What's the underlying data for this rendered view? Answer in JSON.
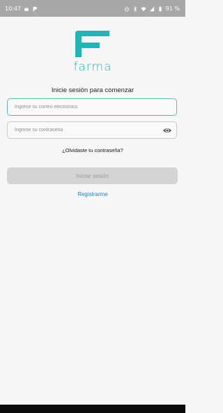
{
  "status_bar": {
    "time": "10:47",
    "battery": "91 %"
  },
  "brand": {
    "name": "farma",
    "color": "#26b3b4"
  },
  "login": {
    "subtitle": "Inicie sesión para comenzar",
    "email_placeholder": "Ingrese su correo electrónico",
    "password_placeholder": "Ingrese su contraseña",
    "forgot_password": "¿Olvidaste tu contraseña?",
    "submit_label": "Iniciar sesión",
    "register_label": "Registrarme"
  },
  "colors": {
    "accent": "#26b3b4",
    "link": "#2a7fb8",
    "disabled_button": "#d4d4d4"
  }
}
